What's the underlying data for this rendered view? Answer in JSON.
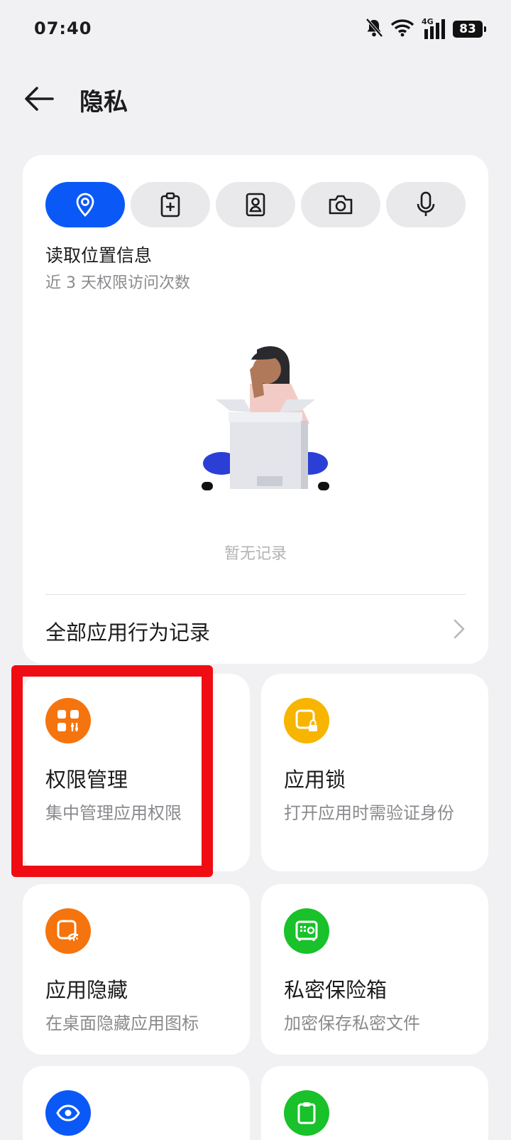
{
  "status_bar": {
    "time": "07:40",
    "network": "4G",
    "battery": "83"
  },
  "header": {
    "title": "隐私"
  },
  "permission_tabs": [
    {
      "icon": "location-icon",
      "active": true
    },
    {
      "icon": "clipboard-plus-icon",
      "active": false
    },
    {
      "icon": "contact-card-icon",
      "active": false
    },
    {
      "icon": "camera-icon",
      "active": false
    },
    {
      "icon": "microphone-icon",
      "active": false
    }
  ],
  "permission_summary": {
    "title": "读取位置信息",
    "subtitle": "近 3 天权限访问次数",
    "empty_text": "暂无记录"
  },
  "all_records": {
    "label": "全部应用行为记录"
  },
  "tiles": [
    {
      "title": "权限管理",
      "desc": "集中管理应用权限",
      "icon": "grid-sliders-icon",
      "color": "#f5740e"
    },
    {
      "title": "应用锁",
      "desc": "打开应用时需验证身份",
      "icon": "app-lock-icon",
      "color": "#f7b500"
    },
    {
      "title": "应用隐藏",
      "desc": "在桌面隐藏应用图标",
      "icon": "hidden-app-icon",
      "color": "#f5740e"
    },
    {
      "title": "私密保险箱",
      "desc": "加密保存私密文件",
      "icon": "safe-icon",
      "color": "#19c12a"
    }
  ],
  "colors": {
    "accent": "#0a59f7",
    "highlight": "#ef0d13"
  }
}
